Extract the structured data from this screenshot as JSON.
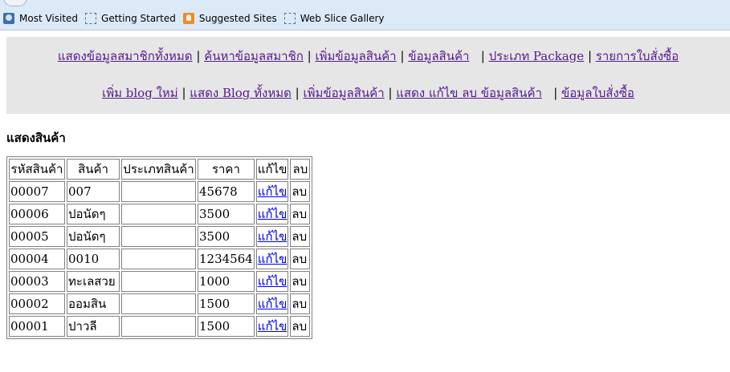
{
  "bookmarks": [
    {
      "label": "Most Visited",
      "icon": "most-visited-icon"
    },
    {
      "label": "Getting Started",
      "icon": "page-icon"
    },
    {
      "label": "Suggested Sites",
      "icon": "suggested-sites-icon"
    },
    {
      "label": "Web Slice Gallery",
      "icon": "page-icon"
    }
  ],
  "nav": {
    "row1": [
      "แสดงข้อมูลสมาชิกทั้งหมด",
      "ค้นหาข้อมูลสมาชิก",
      "เพิ่มข้อมูลสินค้า",
      "ข้อมูลสินค้า",
      "ประเภท Package",
      "รายการใบสั่งซื้อ"
    ],
    "row2": [
      "เพิ่ม blog ใหม่",
      "แสดง Blog ทั้งหมด",
      "เพิ่มข้อมูลสินค้า",
      "แสดง แก้ไข ลบ ข้อมูลสินค้า",
      "ข้อมูลใบสั่งซื้อ"
    ]
  },
  "page_heading": "แสดงสินค้า",
  "table": {
    "headers": [
      "รหัสสินค้า",
      "สินค้า",
      "ประเภทสินค้า",
      "ราคา",
      "แก้ไข",
      "ลบ"
    ],
    "edit_label": "แก้ไข",
    "delete_label": "ลบ",
    "rows": [
      {
        "id": "00007",
        "name": "007",
        "type": "",
        "price": "45678"
      },
      {
        "id": "00006",
        "name": "ปอนัดๆ",
        "type": "",
        "price": "3500"
      },
      {
        "id": "00005",
        "name": "ปอนัดๆ",
        "type": "",
        "price": "3500"
      },
      {
        "id": "00004",
        "name": "0010",
        "type": "",
        "price": "1234564"
      },
      {
        "id": "00003",
        "name": "ทะเลสวย",
        "type": "",
        "price": "1000"
      },
      {
        "id": "00002",
        "name": "ออมสิน",
        "type": "",
        "price": "1500"
      },
      {
        "id": "00001",
        "name": "ปาวลี",
        "type": "",
        "price": "1500"
      }
    ]
  }
}
